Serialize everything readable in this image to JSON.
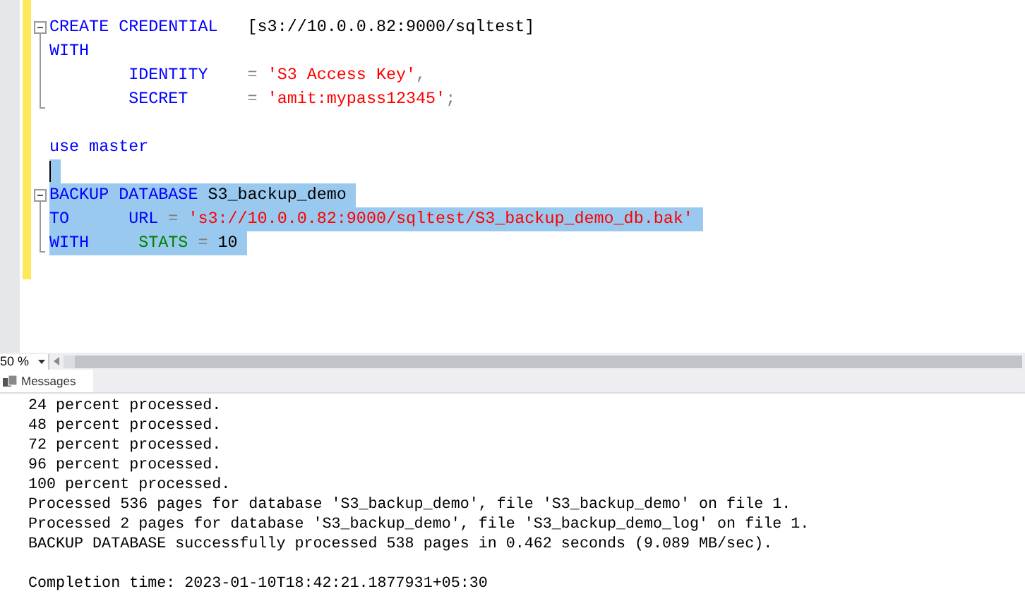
{
  "editor": {
    "lines": [
      {
        "selected": false,
        "kind": "start",
        "tokens": [
          {
            "kind": "keyword",
            "text": "CREATE CREDENTIAL"
          },
          {
            "kind": "plain",
            "text": "   [s3://10.0.0.82:9000/sqltest]"
          }
        ]
      },
      {
        "selected": false,
        "kind": "body",
        "tokens": [
          {
            "kind": "keyword",
            "text": "WITH"
          }
        ]
      },
      {
        "selected": false,
        "kind": "body",
        "tokens": [
          {
            "kind": "keyword",
            "text": "        IDENTITY"
          },
          {
            "kind": "operator",
            "text": "    = "
          },
          {
            "kind": "string",
            "text": "'S3 Access Key'"
          },
          {
            "kind": "operator",
            "text": ","
          }
        ]
      },
      {
        "selected": false,
        "kind": "end",
        "tokens": [
          {
            "kind": "keyword",
            "text": "        SECRET"
          },
          {
            "kind": "operator",
            "text": "      = "
          },
          {
            "kind": "string",
            "text": "'amit:mypass12345'"
          },
          {
            "kind": "operator",
            "text": ";"
          }
        ]
      },
      {
        "selected": false,
        "kind": "plain"
      },
      {
        "selected": false,
        "kind": "plain",
        "tokens": [
          {
            "kind": "keyword",
            "text": "use master"
          }
        ]
      },
      {
        "selected": true,
        "kind": "plain",
        "cursor": true
      },
      {
        "selected": true,
        "kind": "start",
        "tokens": [
          {
            "kind": "keyword",
            "text": "BACKUP DATABASE"
          },
          {
            "kind": "plain",
            "text": " S3_backup_demo"
          }
        ]
      },
      {
        "selected": true,
        "kind": "body",
        "tokens": [
          {
            "kind": "keyword",
            "text": "TO"
          },
          {
            "kind": "keyword",
            "text": "      URL"
          },
          {
            "kind": "operator",
            "text": " = "
          },
          {
            "kind": "string",
            "text": "'s3://10.0.0.82:9000/sqltest/S3_backup_demo_db.bak'"
          }
        ]
      },
      {
        "selected": true,
        "kind": "end",
        "tokens": [
          {
            "kind": "keyword",
            "text": "WITH"
          },
          {
            "kind": "option",
            "text": "     STATS"
          },
          {
            "kind": "operator",
            "text": " = "
          },
          {
            "kind": "plain",
            "text": "10"
          }
        ]
      }
    ]
  },
  "zoom": {
    "value": "50 %"
  },
  "results_tabs": [
    {
      "label": "Messages",
      "selected": true
    }
  ],
  "messages": [
    "24 percent processed.",
    "48 percent processed.",
    "72 percent processed.",
    "96 percent processed.",
    "100 percent processed.",
    "Processed 536 pages for database 'S3_backup_demo', file 'S3_backup_demo' on file 1.",
    "Processed 2 pages for database 'S3_backup_demo', file 'S3_backup_demo_log' on file 1.",
    "BACKUP DATABASE successfully processed 538 pages in 0.462 seconds (9.089 MB/sec)."
  ],
  "completion_time": "Completion time: 2023-01-10T18:42:21.1877931+05:30"
}
